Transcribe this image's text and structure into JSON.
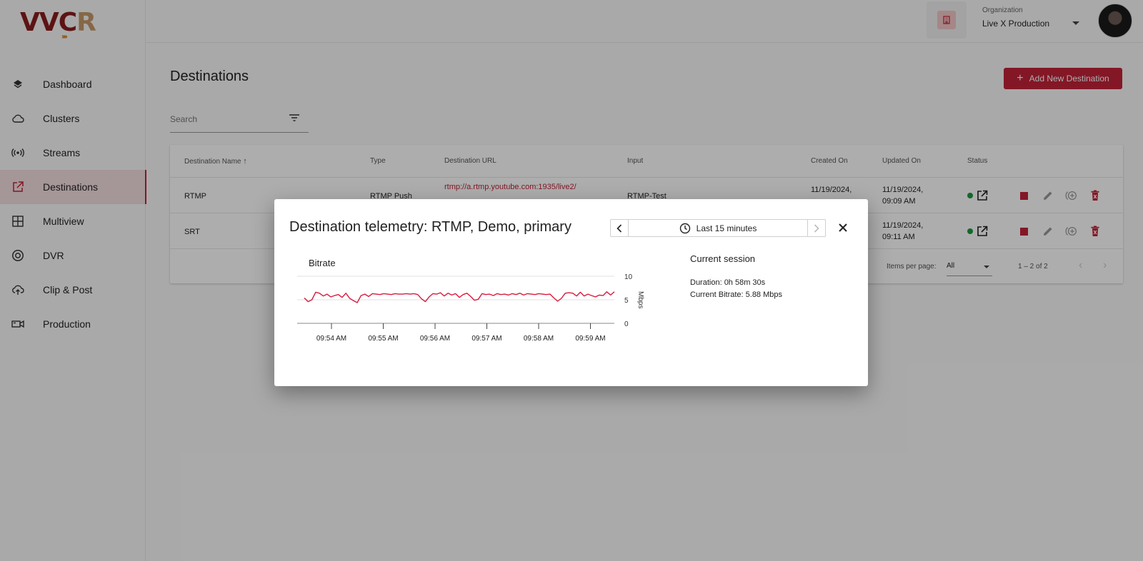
{
  "brand": {
    "logo_a": "VVC",
    "logo_b": "R"
  },
  "sidebar": {
    "items": [
      {
        "label": "Dashboard",
        "icon": "layers-icon"
      },
      {
        "label": "Clusters",
        "icon": "cloud-icon"
      },
      {
        "label": "Streams",
        "icon": "broadcast-icon"
      },
      {
        "label": "Destinations",
        "icon": "external-link-icon",
        "active": true
      },
      {
        "label": "Multiview",
        "icon": "grid-icon"
      },
      {
        "label": "DVR",
        "icon": "record-icon"
      },
      {
        "label": "Clip & Post",
        "icon": "cloud-upload-icon"
      },
      {
        "label": "Production",
        "icon": "video-camera-icon"
      }
    ]
  },
  "header": {
    "org_label": "Organization",
    "org_value": "Live X Production"
  },
  "page": {
    "title": "Destinations",
    "add_button": "Add New Destination",
    "search_placeholder": "Search"
  },
  "table": {
    "columns": [
      "Destination Name",
      "Type",
      "Destination URL",
      "Input",
      "Created On",
      "Updated On",
      "Status"
    ],
    "rows": [
      {
        "name": "RTMP",
        "type": "RTMP Push",
        "url": "rtmp://a.rtmp.youtube.com:1935/live2/",
        "input": "RTMP-Test",
        "created": "11/19/2024,",
        "updated_1": "11/19/2024,",
        "updated_2": "09:09 AM"
      },
      {
        "name": "SRT",
        "type": "",
        "url": "",
        "input": "",
        "created": "",
        "updated_1": "11/19/2024,",
        "updated_2": "09:11 AM"
      }
    ],
    "items_per_page_label": "Items per page:",
    "items_per_page_value": "All",
    "range_label": "1 – 2 of 2"
  },
  "dialog": {
    "title": "Destination telemetry: RTMP, Demo, primary",
    "time_range": "Last 15 minutes",
    "session_title": "Current session",
    "duration": "Duration: 0h 58m 30s",
    "bitrate": "Current Bitrate: 5.88 Mbps"
  },
  "colors": {
    "accent": "#c22339",
    "status_ok": "#1a9b3f",
    "line": "#d81b3f"
  },
  "chart_data": {
    "type": "line",
    "title": "Bitrate",
    "xlabel": "",
    "ylabel": "Mbps",
    "ylim": [
      0,
      10
    ],
    "yticks": [
      0,
      5,
      10
    ],
    "xticks": [
      "09:54 AM",
      "09:55 AM",
      "09:56 AM",
      "09:57 AM",
      "09:58 AM",
      "09:59 AM"
    ],
    "series": [
      {
        "values": [
          5.4,
          4.6,
          5.0,
          6.6,
          6.4,
          5.8,
          6.2,
          5.6,
          5.9,
          6.1,
          5.5,
          6.4,
          5.3,
          4.8,
          4.4,
          5.9,
          6.2,
          5.7,
          6.3,
          6.2,
          6.1,
          6.3,
          6.2,
          6.1,
          6.3,
          6.2,
          6.2,
          6.3,
          6.2,
          6.3,
          6.1,
          5.2,
          4.6,
          5.6,
          6.3,
          6.2,
          6.5,
          5.8,
          6.4,
          6.0,
          6.3,
          5.5,
          6.1,
          6.4,
          5.7,
          4.9,
          5.1,
          6.3,
          6.1,
          6.2,
          5.9,
          6.3,
          6.1,
          6.2,
          6.0,
          6.3,
          6.1,
          6.4,
          6.0,
          6.3,
          6.2,
          6.1,
          6.3,
          6.2,
          6.1,
          6.2,
          5.4,
          4.7,
          5.3,
          6.4,
          6.5,
          6.4,
          5.8,
          6.6,
          5.8,
          6.2,
          5.9,
          5.6,
          6.0,
          5.9,
          6.7,
          6.0,
          6.7
        ]
      }
    ],
    "grid": true
  }
}
